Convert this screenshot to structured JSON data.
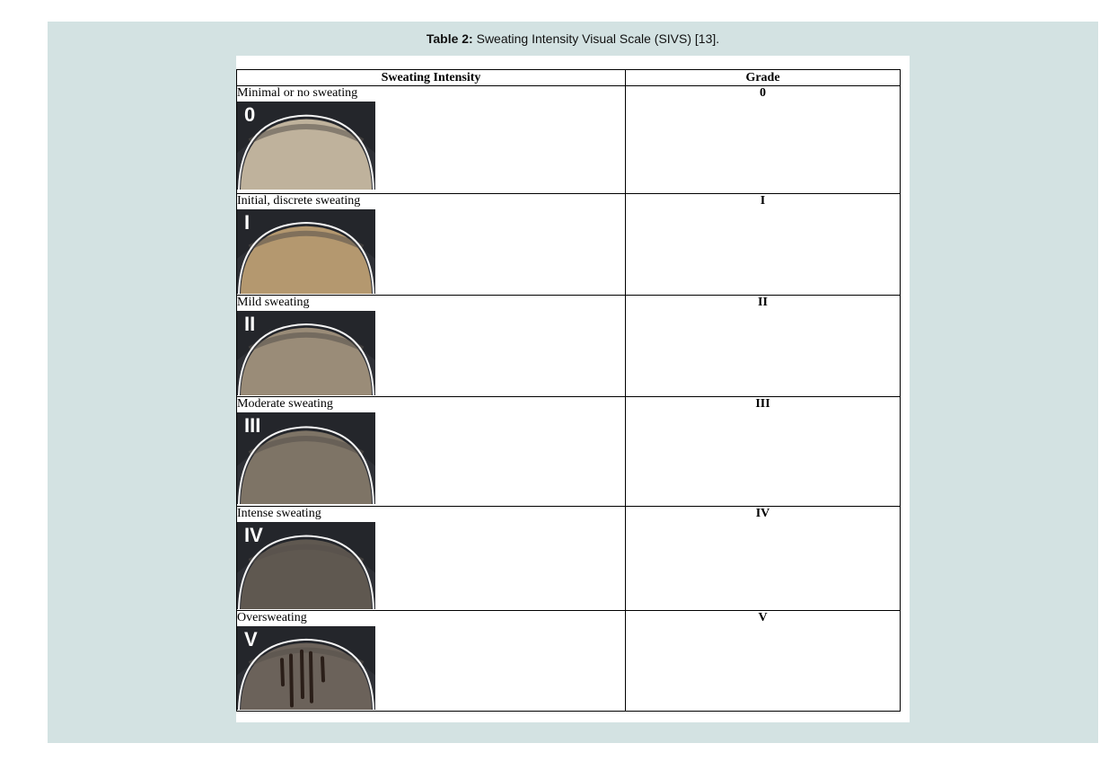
{
  "caption": {
    "label": "Table 2:",
    "text": " Sweating Intensity Visual Scale (SIVS) [13]."
  },
  "table": {
    "headers": {
      "intensity": "Sweating Intensity",
      "grade": "Grade"
    },
    "rows": [
      {
        "intensity": "Minimal or no sweating",
        "grade": "0",
        "photo_label": "0",
        "skin": "#bfb29c",
        "spots": false
      },
      {
        "intensity": "Initial, discrete sweating",
        "grade": "I",
        "photo_label": "I",
        "skin": "#b4986f",
        "spots": false
      },
      {
        "intensity": "Mild sweating",
        "grade": "II",
        "photo_label": "II",
        "skin": "#9a8c78",
        "spots": false
      },
      {
        "intensity": "Moderate sweating",
        "grade": "III",
        "photo_label": "III",
        "skin": "#7e7466",
        "spots": false
      },
      {
        "intensity": "Intense sweating",
        "grade": "IV",
        "photo_label": "IV",
        "skin": "#5f5850",
        "spots": false
      },
      {
        "intensity": "Oversweating",
        "grade": "V",
        "photo_label": "V",
        "skin": "#6b625a",
        "spots": true
      }
    ]
  },
  "colors": {
    "panel_background": "#d3e2e2",
    "sheet_background": "#ffffff",
    "border": "#000000"
  }
}
